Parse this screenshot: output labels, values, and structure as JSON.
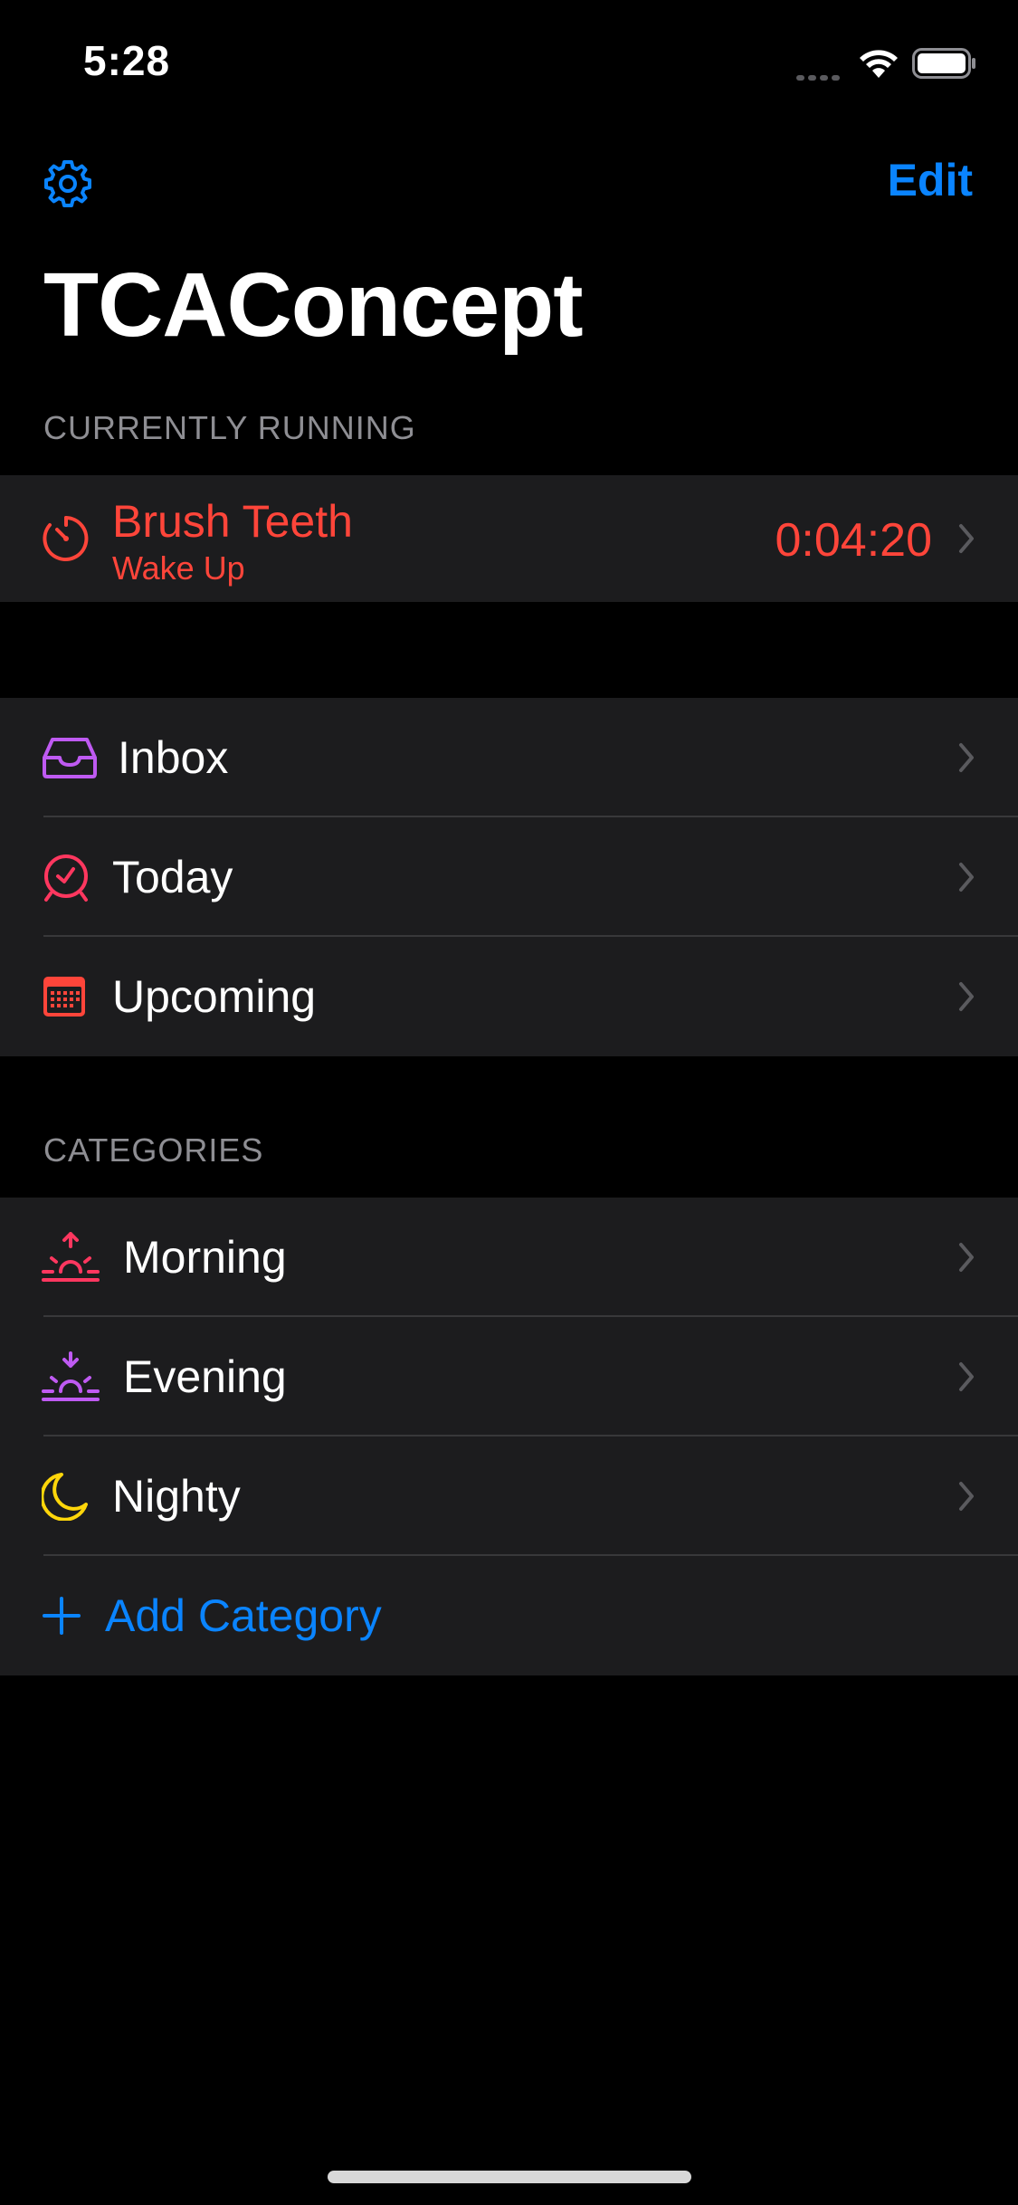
{
  "status": {
    "time": "5:28"
  },
  "nav": {
    "edit_label": "Edit",
    "settings_icon": "gear-icon"
  },
  "title": "TCAConcept",
  "running": {
    "header": "CURRENTLY RUNNING",
    "task": "Brush Teeth",
    "category": "Wake Up",
    "elapsed": "0:04:20",
    "icon": "timer-icon",
    "color": "#ff453a"
  },
  "lists": [
    {
      "label": "Inbox",
      "icon": "inbox-icon",
      "color": "#bf5af2"
    },
    {
      "label": "Today",
      "icon": "alarm-clock-icon",
      "color": "#ff375f"
    },
    {
      "label": "Upcoming",
      "icon": "calendar-icon",
      "color": "#ff453a"
    }
  ],
  "categories": {
    "header": "CATEGORIES",
    "items": [
      {
        "label": "Morning",
        "icon": "sunrise-icon",
        "color": "#ff375f"
      },
      {
        "label": "Evening",
        "icon": "sunset-icon",
        "color": "#bf5af2"
      },
      {
        "label": "Nighty",
        "icon": "moon-icon",
        "color": "#ffd60a"
      }
    ],
    "add_label": "Add Category"
  },
  "colors": {
    "accent": "#0a84ff",
    "background": "#000000",
    "cell": "#1c1c1e"
  }
}
